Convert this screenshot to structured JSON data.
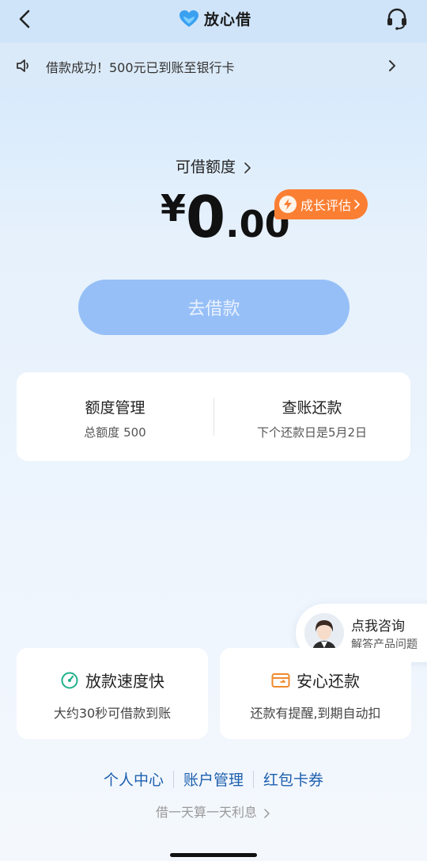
{
  "header": {
    "title": "放心借",
    "colors": {
      "brand": "#3aa0f0",
      "accent": "#fb7f33"
    }
  },
  "notice": {
    "text": "借款成功！500元已到账至银行卡"
  },
  "credit": {
    "label": "可借额度",
    "currency": "¥",
    "amount_int": "0",
    "amount_dec": ".00",
    "growth_label": "成长评估"
  },
  "borrow_button": {
    "label": "去借款"
  },
  "management": {
    "quota": {
      "title": "额度管理",
      "subtitle": "总额度 500"
    },
    "repay": {
      "title": "查账还款",
      "subtitle": "下个还款日是5月2日"
    }
  },
  "consult": {
    "title": "点我咨询",
    "subtitle": "解答产品问题"
  },
  "features": [
    {
      "title": "放款速度快",
      "desc": "大约30秒可借款到账",
      "icon": "speed-icon"
    },
    {
      "title": "安心还款",
      "desc": "还款有提醒,到期自动扣",
      "icon": "wallet-icon"
    }
  ],
  "links": {
    "personal": "个人中心",
    "account": "账户管理",
    "coupons": "红包卡券"
  },
  "footer_note": "借一天算一天利息"
}
